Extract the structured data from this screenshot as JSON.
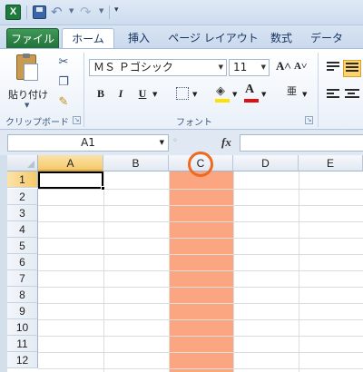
{
  "window": {
    "app_icon": "excel-icon",
    "qat": {
      "save": "save-icon",
      "undo": "↶",
      "redo": "↷",
      "customize": "customize-qat-icon"
    }
  },
  "tabs": [
    {
      "label": "ファイル"
    },
    {
      "label": "ホーム"
    },
    {
      "label": "挿入"
    },
    {
      "label": "ページ レイアウト"
    },
    {
      "label": "数式"
    },
    {
      "label": "データ"
    }
  ],
  "ribbon": {
    "clipboard": {
      "paste_label": "貼り付け",
      "group_label": "クリップボード"
    },
    "font": {
      "font_name": "ＭＳ Ｐゴシック",
      "font_size": "11",
      "bold": "B",
      "italic": "I",
      "underline": "U",
      "font_color_glyph": "A",
      "grow_glyph": "A˄",
      "shrink_glyph": "A˅",
      "kana_glyph": "亜",
      "group_label": "フォント"
    },
    "colors": {
      "fill": "#ffe000",
      "font": "#e01010"
    }
  },
  "formula_bar": {
    "name_box": "A1",
    "fx": "fx",
    "formula": ""
  },
  "sheet": {
    "columns": [
      "A",
      "B",
      "C",
      "D",
      "E"
    ],
    "rows": [
      "1",
      "2",
      "3",
      "4",
      "5",
      "6",
      "7",
      "8",
      "9",
      "10",
      "11",
      "12"
    ],
    "active_cell": "A1",
    "highlighted_column": "C",
    "highlight_color": "#fba681",
    "annotation_color": "#ee6a22"
  }
}
